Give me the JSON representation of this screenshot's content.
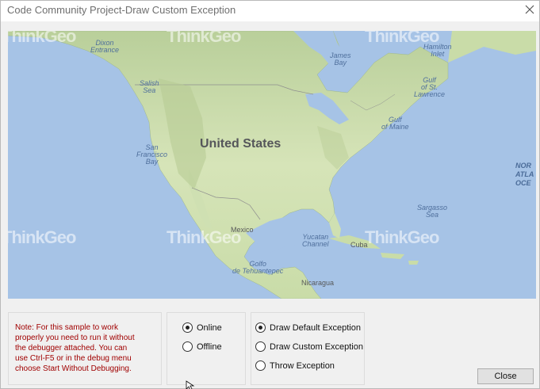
{
  "window": {
    "title": "Code Community Project-Draw Custom Exception"
  },
  "map": {
    "country_label": "United States",
    "watermark": "ThinkGeo",
    "labels": {
      "dixon_entrance": [
        "Dixon",
        "Entrance"
      ],
      "james_bay": [
        "James",
        "Bay"
      ],
      "hamilton_inlet": [
        "Hamilton",
        "Inlet"
      ],
      "salish_sea": [
        "Salish",
        "Sea"
      ],
      "gulf_st_lawrence": [
        "Gulf",
        "of St.",
        "Lawrence"
      ],
      "gulf_of_maine": [
        "Gulf",
        "of Maine"
      ],
      "san_francisco_bay": [
        "San",
        "Francisco",
        "Bay"
      ],
      "north_atlantic": [
        "NOR",
        "ATLA",
        "OCE"
      ],
      "sargasso_sea": [
        "Sargasso",
        "Sea"
      ],
      "mexico": "Mexico",
      "yucatan_channel": [
        "Yucatan",
        "Channel"
      ],
      "cuba": "Cuba",
      "golfo_tehuantepec": [
        "Golfo",
        "de Tehuantepec"
      ],
      "nicaragua": "Nicaragua"
    }
  },
  "note": {
    "lines": [
      "Note: For this sample to work",
      "properly you need to run it without",
      "the debugger attached.  You can",
      "use Ctrl-F5 or in the debug menu",
      "choose Start Without Debugging."
    ]
  },
  "mode_options": [
    {
      "label": "Online",
      "checked": true
    },
    {
      "label": "Offline",
      "checked": false
    }
  ],
  "exception_options": [
    {
      "label": "Draw Default Exception",
      "checked": true
    },
    {
      "label": "Draw Custom Exception",
      "checked": false
    },
    {
      "label": "Throw Exception",
      "checked": false
    }
  ],
  "buttons": {
    "close_label": "Close"
  },
  "colors": {
    "water": "#a6c3e6",
    "land": "#cfe0b2",
    "note_text": "#a00000"
  }
}
